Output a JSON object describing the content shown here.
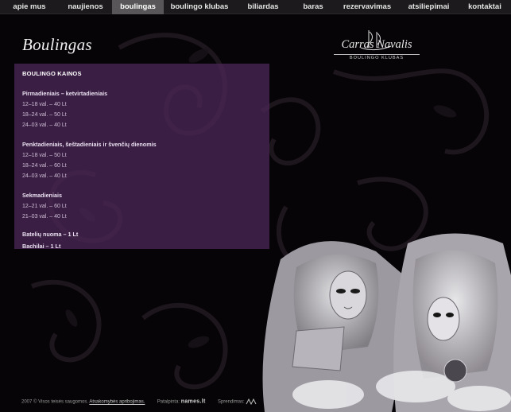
{
  "nav": {
    "items": [
      {
        "label": "apie mus",
        "active": false
      },
      {
        "label": "naujienos",
        "active": false
      },
      {
        "label": "boulingas",
        "active": true
      },
      {
        "label": "boulingo klubas",
        "active": false
      },
      {
        "label": "biliardas",
        "active": false
      },
      {
        "label": "baras",
        "active": false
      },
      {
        "label": "rezervavimas",
        "active": false
      },
      {
        "label": "atsiliepimai",
        "active": false
      },
      {
        "label": "kontaktai",
        "active": false
      }
    ]
  },
  "page": {
    "title": "Boulingas"
  },
  "logo": {
    "name": "Carras Navalis",
    "subtitle": "BOULINGO KLUBAS"
  },
  "prices": {
    "heading": "BOULINGO KAINOS",
    "groups": [
      {
        "title": "Pirmadieniais – ketvirtadieniais",
        "rows": [
          "12–18 val. – 40 Lt",
          "18–24 val. – 50 Lt",
          "24–03 val. – 40 Lt"
        ]
      },
      {
        "title": "Penktadieniais, šeštadieniais ir švenčių dienomis",
        "rows": [
          "12–18 val. – 50 Lt",
          "18–24 val. – 60 Lt",
          "24–03 val. – 40 Lt"
        ]
      },
      {
        "title": "Sekmadieniais",
        "rows": [
          "12–21 val. – 60 Lt",
          "21–03 val. – 40 Lt"
        ]
      }
    ],
    "extras": [
      "Batelių nuoma – 1 Lt",
      "Bachilai – 1 Lt"
    ]
  },
  "footer": {
    "copyright": "2007 © Visos teisės saugomos.",
    "disclaimer_link": "Atsakomybės apribojimas.",
    "hosting_label": "Patalpinta:",
    "hosting_name": "names.lt",
    "solution_label": "Sprendimas:"
  },
  "colors": {
    "background": "#060406",
    "panel": "#4a2656",
    "nav_bar": "#1c1a1c",
    "nav_active": "#585658"
  }
}
